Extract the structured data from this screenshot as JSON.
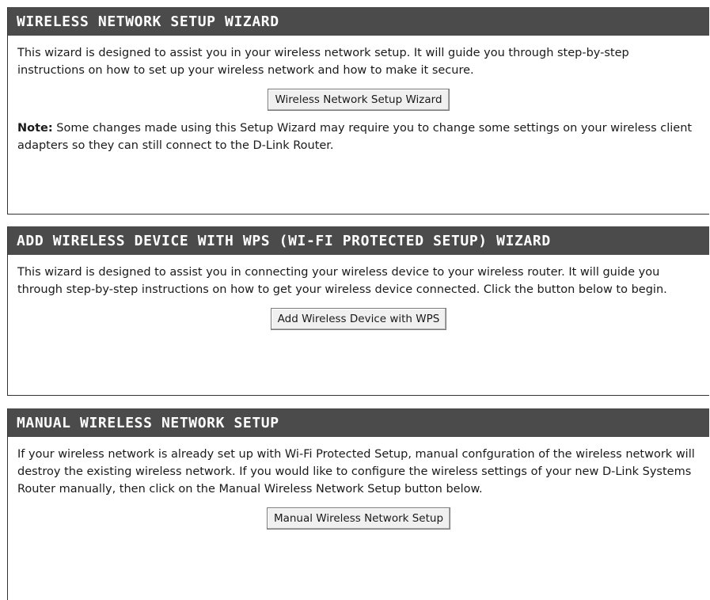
{
  "sections": [
    {
      "title": "WIRELESS NETWORK SETUP WIZARD",
      "description": "This wizard is designed to assist you in your wireless network setup. It will guide you through step-by-step instructions on how to set up your wireless network and how to make it secure.",
      "button_label": "Wireless Network Setup Wizard",
      "note_label": "Note:",
      "note_text": " Some changes made using this Setup Wizard may require you to change some settings on your wireless client adapters so they can still connect to the D-Link Router."
    },
    {
      "title": "ADD WIRELESS DEVICE WITH WPS (WI-FI PROTECTED SETUP) WIZARD",
      "description": "This wizard is designed to assist you in connecting your wireless device to your wireless router. It will guide you through step-by-step instructions on how to get your wireless device connected. Click the button below to begin.",
      "button_label": "Add Wireless Device with WPS"
    },
    {
      "title": "MANUAL WIRELESS NETWORK SETUP",
      "description": "If your wireless network is already set up with Wi-Fi Protected Setup, manual confguration of the wireless network will destroy the existing wireless network. If you would like to configure the wireless settings of your new D-Link Systems Router manually, then click on the Manual Wireless Network Setup button below.",
      "button_label": "Manual Wireless Network Setup"
    }
  ]
}
